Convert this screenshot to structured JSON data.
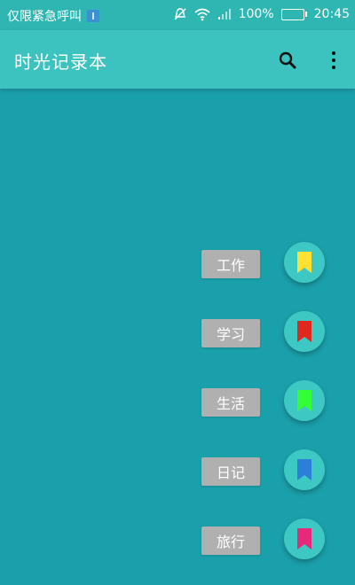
{
  "status_bar": {
    "carrier_text": "仅限紧急呼叫",
    "battery_percent": "100%",
    "time": "20:45",
    "icons": [
      "usb-debug-icon",
      "silent-icon",
      "wifi-icon",
      "signal-icon",
      "battery-charging-icon"
    ],
    "battery_level": 1.0
  },
  "app_bar": {
    "title": "时光记录本",
    "actions": [
      "search-icon",
      "more-vert-icon"
    ]
  },
  "categories": [
    {
      "label": "工作",
      "icon": "bookmark-icon",
      "color": "#ffe033"
    },
    {
      "label": "学习",
      "icon": "bookmark-icon",
      "color": "#e0281e"
    },
    {
      "label": "生活",
      "icon": "bookmark-icon",
      "color": "#33ff33"
    },
    {
      "label": "日记",
      "icon": "bookmark-icon",
      "color": "#2b7fd8"
    },
    {
      "label": "旅行",
      "icon": "bookmark-icon",
      "color": "#e8287a"
    }
  ],
  "colors": {
    "background": "#1aa0ab",
    "status_bar": "#2fb6b3",
    "app_bar": "#3cc2bf",
    "fab": "#3ec8c3",
    "label_bg": "#b0b0b0"
  }
}
